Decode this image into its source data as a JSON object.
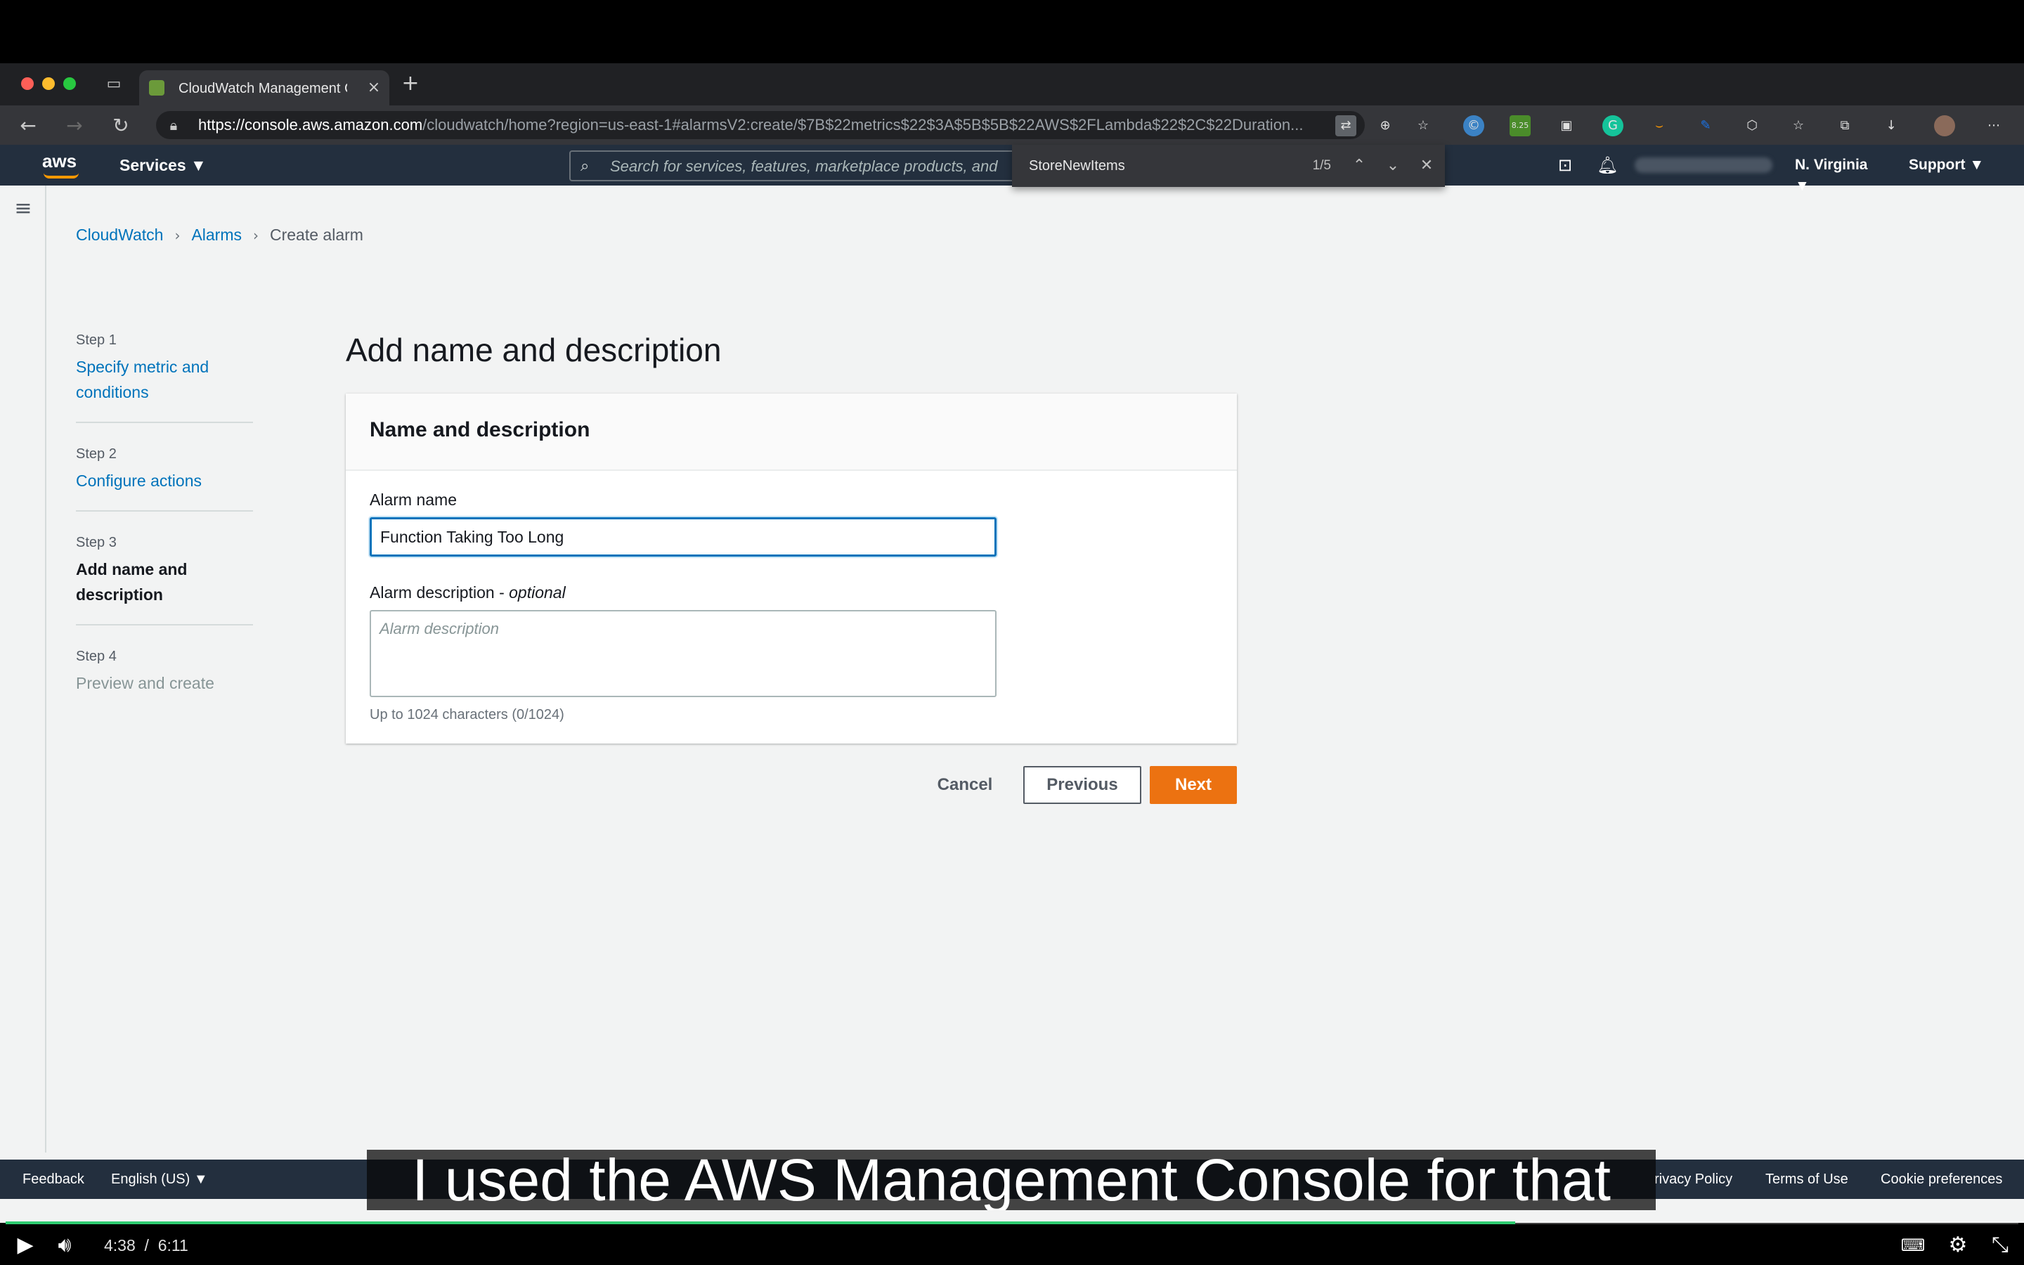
{
  "browser": {
    "tab_title": "CloudWatch Management Con",
    "url_host": "https://console.aws.amazon.com",
    "url_path": "/cloudwatch/home?region=us-east-1#alarmsV2:create/$7B$22metrics$22$3A$5B$5B$22AWS$2FLambda$22$2C$22Duration...",
    "extension_badge": "8.25"
  },
  "aws_header": {
    "logo": "aws",
    "services_label": "Services ▼",
    "search_placeholder": "Search for services, features, marketplace products, and",
    "region_label": "N. Virginia ▼",
    "support_label": "Support ▼"
  },
  "find_bar": {
    "query": "StoreNewItems",
    "count": "1/5"
  },
  "breadcrumb": {
    "items": [
      "CloudWatch",
      "Alarms",
      "Create alarm"
    ]
  },
  "steps": [
    {
      "num": "Step 1",
      "label": "Specify metric and conditions"
    },
    {
      "num": "Step 2",
      "label": "Configure actions"
    },
    {
      "num": "Step 3",
      "label": "Add name and description"
    },
    {
      "num": "Step 4",
      "label": "Preview and create"
    }
  ],
  "page_title": "Add name and description",
  "panel": {
    "title": "Name and description",
    "alarm_name_label": "Alarm name",
    "alarm_name_value": "Function Taking Too Long",
    "alarm_desc_label": "Alarm description - ",
    "alarm_desc_optional": "optional",
    "alarm_desc_placeholder": "Alarm description",
    "help_text": "Up to 1024 characters (0/1024)"
  },
  "actions": {
    "cancel": "Cancel",
    "previous": "Previous",
    "next": "Next"
  },
  "footer": {
    "feedback": "Feedback",
    "language": "English (US) ▼",
    "privacy": "rivacy Policy",
    "terms": "Terms of Use",
    "cookies": "Cookie preferences"
  },
  "video": {
    "caption": "I used the AWS Management Console for that",
    "current_time": "4:38",
    "separator": "/",
    "duration": "6:11",
    "progress_fraction": 0.75
  }
}
